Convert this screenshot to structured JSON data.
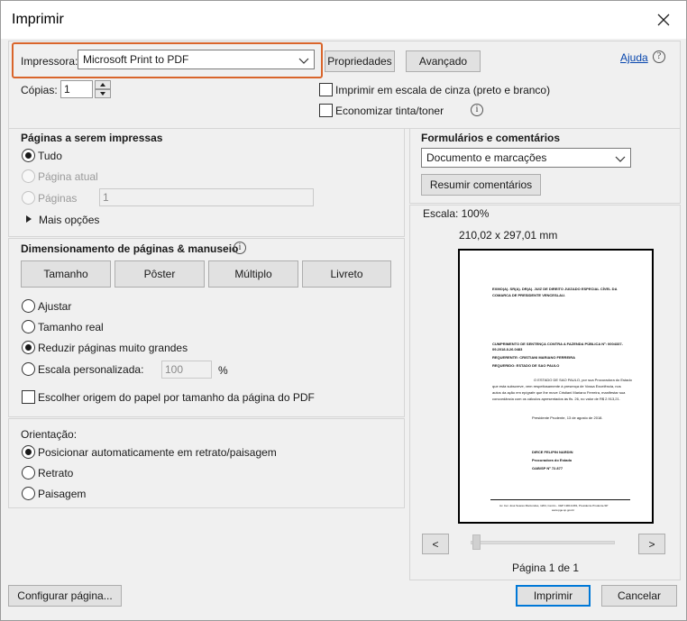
{
  "window": {
    "title": "Imprimir"
  },
  "printer": {
    "label": "Impressora:",
    "selected": "Microsoft Print to PDF",
    "properties_label": "Propriedades",
    "advanced_label": "Avançado",
    "help_label": "Ajuda"
  },
  "copies": {
    "label": "Cópias:",
    "value": "1"
  },
  "options": {
    "grayscale_label": "Imprimir em escala de cinza (preto e branco)",
    "save_ink_label": "Economizar tinta/toner"
  },
  "pages": {
    "title": "Páginas a serem impressas",
    "all_label": "Tudo",
    "current_label": "Página atual",
    "pages_label": "Páginas",
    "pages_value": "1",
    "more_options_label": "Mais opções"
  },
  "sizing": {
    "title": "Dimensionamento de páginas & manuseio",
    "buttons": [
      "Tamanho",
      "Pôster",
      "Múltiplo",
      "Livreto"
    ],
    "fit_label": "Ajustar",
    "actual_label": "Tamanho real",
    "shrink_label": "Reduzir páginas muito grandes",
    "custom_label": "Escala personalizada:",
    "custom_value": "100",
    "percent": "%",
    "paper_source_label": "Escolher origem do papel por tamanho da página do PDF"
  },
  "orientation": {
    "title": "Orientação:",
    "auto_label": "Posicionar automaticamente em retrato/paisagem",
    "portrait_label": "Retrato",
    "landscape_label": "Paisagem"
  },
  "forms": {
    "title": "Formulários e comentários",
    "selected": "Documento e marcações",
    "summarize_label": "Resumir comentários"
  },
  "preview": {
    "scale_label": "Escala: 100%",
    "dimensions": "210,02 x 297,01 mm",
    "prev_label": "<",
    "next_label": ">",
    "page_indicator": "Página 1 de 1",
    "doc_lines": [
      "EXMO(A). SR(A). DR(A). JUIZ DE DIREITO JUIZADO ESPECIAL CÍVEL DA",
      "COMARCA DE PRESIDENTE VENCESLAU.",
      "CUMPRIMENTO DE SENTENÇA CONTRA A FAZENDA PÚBLICA Nº: 0004337-",
      "09.2018.8.26.0483",
      "REQUERENTE: CRISTIANI MARIANO FERREIRA",
      "REQUERIDO: ESTADO DE SAO PAULO",
      "O ESTADO DE SAO PAULO, por sua Procuradora do Estado",
      "que esta subscreve, vem respeitosamente à presença de Vossa Excelência, nos",
      "autos da ação em epígrafe que lhe move Cristiani Mariano Ferreira, manifestar sua",
      "concordância com os cálculos apresentados às fls. 26, no valor de R$ 2.913,21.",
      "Presidente Prudente, 13 de agosto de 2018.",
      "DIRCE FELIPIN NARDIN",
      "Procuradora do Estado",
      "OAB/SP Nº 72.877",
      "Av. Cel. José Soares Marcondes, 1264, Centro - CEP 19010-081, Presidente Prudente-SP",
      "www.pge.sp.gov.br"
    ]
  },
  "footer": {
    "page_setup_label": "Configurar página...",
    "print_label": "Imprimir",
    "cancel_label": "Cancelar"
  }
}
